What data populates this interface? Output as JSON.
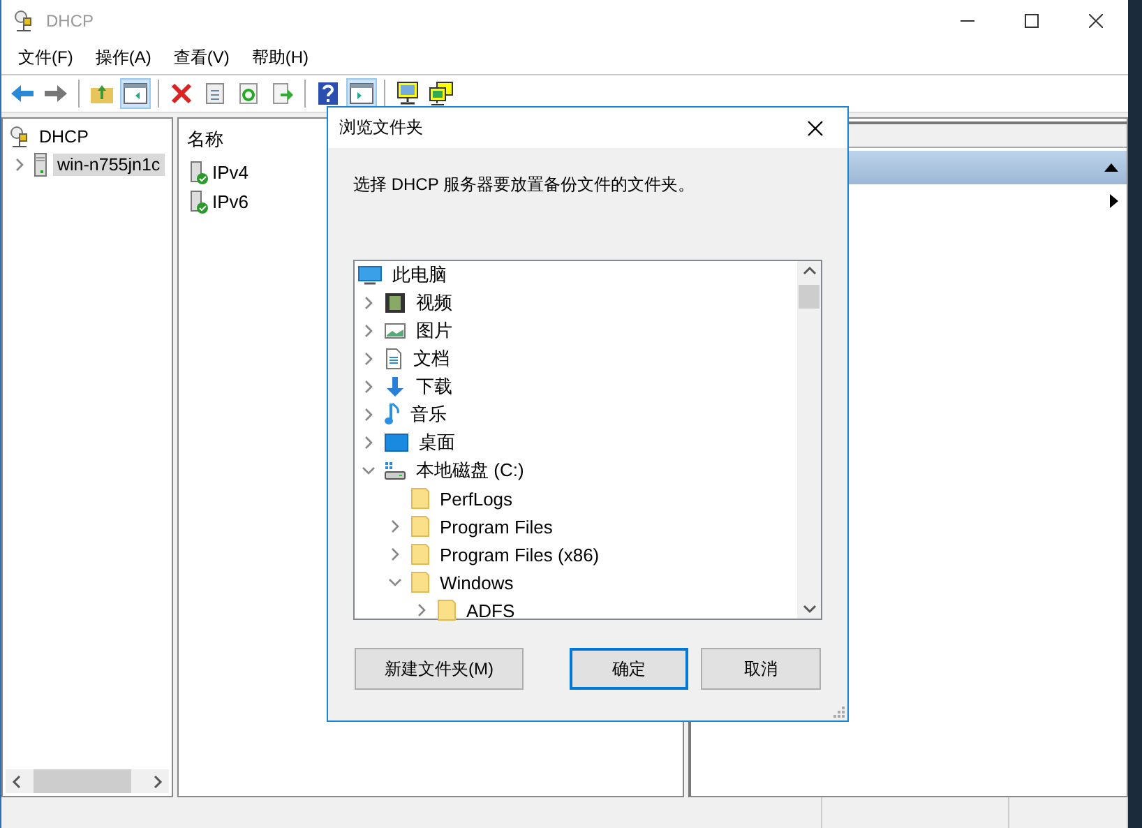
{
  "window": {
    "title": "DHCP"
  },
  "menu": [
    "文件(F)",
    "操作(A)",
    "查看(V)",
    "帮助(H)"
  ],
  "toolbar": [
    [
      {
        "kind": "back",
        "selected": false
      },
      {
        "kind": "forward",
        "selected": false
      }
    ],
    [
      {
        "kind": "up",
        "selected": false
      },
      {
        "kind": "tree",
        "selected": true
      }
    ],
    [
      {
        "kind": "delete",
        "selected": false
      },
      {
        "kind": "properties",
        "selected": false
      },
      {
        "kind": "refresh",
        "selected": false
      },
      {
        "kind": "export",
        "selected": false
      }
    ],
    [
      {
        "kind": "help",
        "selected": false
      },
      {
        "kind": "actions",
        "selected": true
      }
    ],
    [
      {
        "kind": "monitor",
        "selected": false
      },
      {
        "kind": "monitors",
        "selected": false
      }
    ]
  ],
  "console_tree": [
    {
      "label": "DHCP",
      "kind": "dhcp",
      "selected": false,
      "children": [
        {
          "label": "win-n755jn1c",
          "kind": "server",
          "selected": true,
          "expanded": false
        }
      ]
    }
  ],
  "list": {
    "column": "名称",
    "rows": [
      "IPv4",
      "IPv6"
    ]
  },
  "dialog": {
    "title": "浏览文件夹",
    "description": "选择 DHCP 服务器要放置备份文件的文件夹。",
    "tree": [
      {
        "label": "此电脑",
        "kind": "pc",
        "children": [
          {
            "label": "视频",
            "kind": "video",
            "expandable": true,
            "expanded": false
          },
          {
            "label": "图片",
            "kind": "pictures",
            "expandable": true,
            "expanded": false
          },
          {
            "label": "文档",
            "kind": "documents",
            "expandable": true,
            "expanded": false
          },
          {
            "label": "下载",
            "kind": "downloads",
            "expandable": true,
            "expanded": false
          },
          {
            "label": "音乐",
            "kind": "music",
            "expandable": true,
            "expanded": false
          },
          {
            "label": "桌面",
            "kind": "desktop",
            "expandable": true,
            "expanded": false
          },
          {
            "label": "本地磁盘 (C:)",
            "kind": "drive",
            "expandable": true,
            "expanded": true,
            "children": [
              {
                "label": "PerfLogs",
                "kind": "folder",
                "expandable": false,
                "expanded": false
              },
              {
                "label": "Program Files",
                "kind": "folder",
                "expandable": true,
                "expanded": false
              },
              {
                "label": "Program Files (x86)",
                "kind": "folder",
                "expandable": true,
                "expanded": false
              },
              {
                "label": "Windows",
                "kind": "folder",
                "expandable": true,
                "expanded": true,
                "children": [
                  {
                    "label": "ADFS",
                    "kind": "folder",
                    "expandable": true,
                    "expanded": false
                  }
                ]
              }
            ]
          }
        ]
      }
    ],
    "buttons": [
      {
        "label": "新建文件夹(M)",
        "default": false
      },
      {
        "label": "确定",
        "default": true
      },
      {
        "label": "取消",
        "default": false
      }
    ]
  }
}
